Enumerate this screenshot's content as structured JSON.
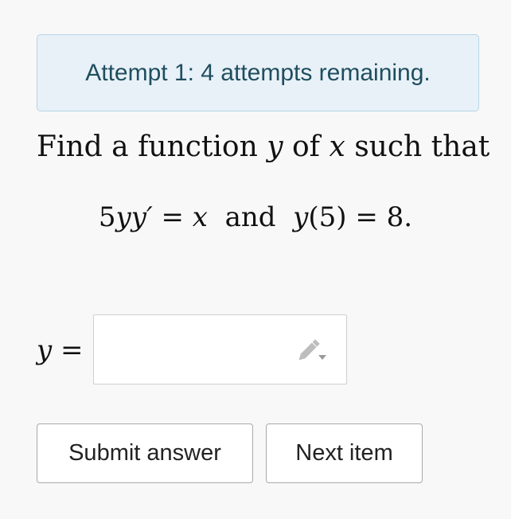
{
  "attempt_banner": {
    "text": "Attempt 1: 4 attempts remaining."
  },
  "question": {
    "prefix": "Find a function ",
    "var_y": "y",
    "middle": " of ",
    "var_x": "x",
    "suffix": " such that"
  },
  "equation": {
    "coeff": "5",
    "lhs_var": "yy′",
    "eq1": " = ",
    "rhs_var": "x",
    "and": "  and  ",
    "func": "y",
    "arg": "(5)",
    "eq2": " = ",
    "value": "8."
  },
  "answer": {
    "label_var": "y",
    "label_eq": " =",
    "value": "",
    "edit_icon": "pencil-dropdown-icon"
  },
  "buttons": {
    "submit_label": "Submit answer",
    "next_label": "Next item"
  },
  "colors": {
    "banner_bg": "#e8f1f8",
    "banner_border": "#b6d4e6",
    "banner_text": "#1f4e5f"
  }
}
